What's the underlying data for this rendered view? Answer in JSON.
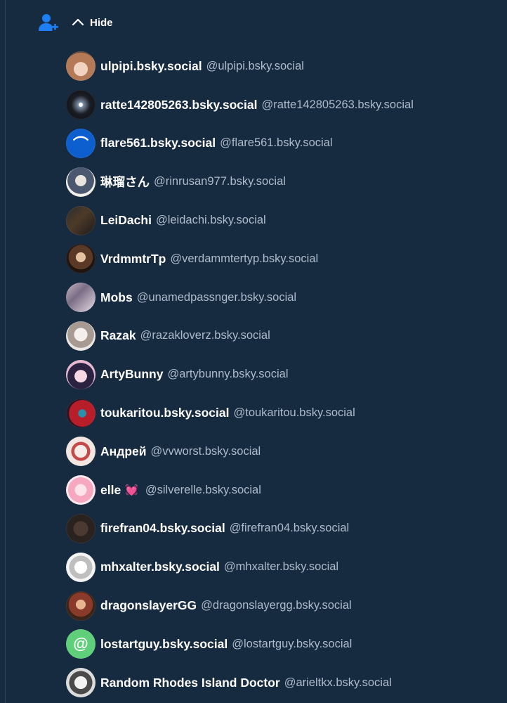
{
  "header": {
    "hide_label": "Hide"
  },
  "users": [
    {
      "name": "ulpipi.bsky.social",
      "handle": "@ulpipi.bsky.social",
      "avatar_bg": "radial-gradient(circle at 50% 60%, #f2d3c2 0 30%, #b47a58 31% 70%, #6a4a3a 71%)"
    },
    {
      "name": "ratte142805263.bsky.social",
      "handle": "@ratte142805263.bsky.social",
      "avatar_bg": "radial-gradient(circle at 50% 50%, #ffffff 0 8%, #7d8fa6 12%, #1a1d24 45%, #0b0d12 100%)"
    },
    {
      "name": "flare561.bsky.social",
      "handle": "@flare561.bsky.social",
      "avatar_bg": "#0d5fd0",
      "glyph": "⌒"
    },
    {
      "name": "琳瑠さん",
      "handle": "@rinrusan977.bsky.social",
      "avatar_bg": "radial-gradient(circle at 50% 45%, #e9e4de 0 25%, #4b5870 26% 60%, #f1efe9 61%)"
    },
    {
      "name": "LeiDachi",
      "handle": "@leidachi.bsky.social",
      "avatar_bg": "linear-gradient(135deg, #2b2b2b 0%, #4d3a28 45%, #1b1b1b 100%)"
    },
    {
      "name": "VrdmmtrTp",
      "handle": "@verdammtertyp.bsky.social",
      "avatar_bg": "radial-gradient(circle at 50% 45%, #e6c3a0 0 22%, #5a3a26 23% 55%, #1e1410 56%)"
    },
    {
      "name": "Mobs",
      "handle": "@unamedpassnger.bsky.social",
      "avatar_bg": "linear-gradient(135deg, #c9b7c4 0%, #7a6d86 40%, #e8dde5 100%)"
    },
    {
      "name": "Razak",
      "handle": "@razakloverz.bsky.social",
      "avatar_bg": "radial-gradient(circle at 50% 45%, #f4efec 0 30%, #a79a93 31% 60%, #e9e6e3 61%)"
    },
    {
      "name": "ArtyBunny",
      "handle": "@artybunny.bsky.social",
      "avatar_bg": "radial-gradient(circle at 50% 55%, #f7d7e3 0 28%, #2b2140 29% 60%, #e7b8d0 61%)"
    },
    {
      "name": "toukaritou.bsky.social",
      "handle": "@toukaritou.bsky.social",
      "avatar_bg": "radial-gradient(circle at 55% 50%, #2a8fa8 0 18%, #b81e2a 19% 60%, #2a1624 61%)"
    },
    {
      "name": "Андрей",
      "handle": "@vvworst.bsky.social",
      "avatar_bg": "radial-gradient(circle at 50% 50%, #f6ece8 0 30%, #c54a4a 31% 45%, #f1e6e2 46%)"
    },
    {
      "name": "elle",
      "handle": "@silverelle.bsky.social",
      "heart": "💓",
      "avatar_bg": "radial-gradient(circle at 50% 50%, #ffe3ea 0 28%, #f6a8c1 29% 60%, #fde9ef 61%)"
    },
    {
      "name": "firefran04.bsky.social",
      "handle": "@firefran04.bsky.social",
      "avatar_bg": "radial-gradient(circle at 50% 50%, #4a3a32 0 35%, #2a221e 36% 70%, #1b1512 71%)"
    },
    {
      "name": "mhxalter.bsky.social",
      "handle": "@mhxalter.bsky.social",
      "avatar_bg": "radial-gradient(circle at 50% 50%, #ffffff 0 30%, #bfbfbf 31% 55%, #f4f4f4 56%)"
    },
    {
      "name": "dragonslayerGG",
      "handle": "@dragonslayergg.bsky.social",
      "avatar_bg": "radial-gradient(circle at 50% 45%, #e6b48f 0 22%, #8a3a2a 23% 55%, #3a2418 56%)"
    },
    {
      "name": "lostartguy.bsky.social",
      "handle": "@lostartguy.bsky.social",
      "avatar_bg": "#5fcf7a",
      "glyph": "@"
    },
    {
      "name": "Random Rhodes Island Doctor",
      "handle": "@arieltkx.bsky.social",
      "avatar_bg": "radial-gradient(circle at 50% 50%, #f2f2f2 0 30%, #4a4a4a 31% 55%, #dcdcdc 56%)"
    }
  ]
}
